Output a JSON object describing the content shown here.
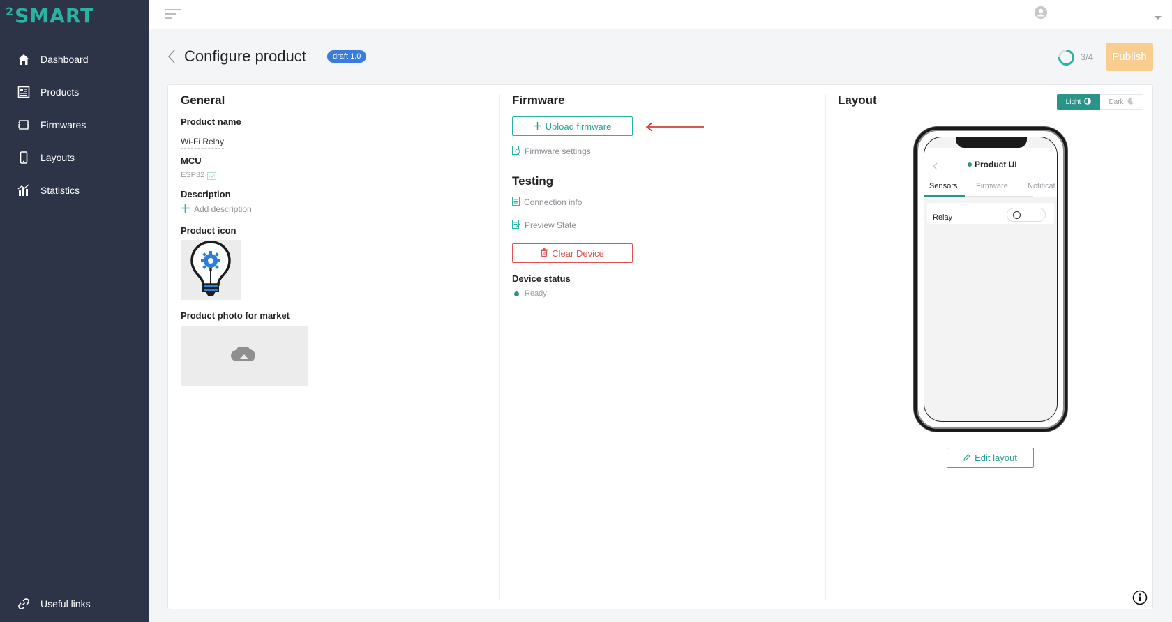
{
  "app": {
    "logo_text": "SMART",
    "logo_sup": "2"
  },
  "sidebar": {
    "items": [
      {
        "label": "Dashboard",
        "icon": "home-icon"
      },
      {
        "label": "Products",
        "icon": "products-icon"
      },
      {
        "label": "Firmwares",
        "icon": "firmwares-icon"
      },
      {
        "label": "Layouts",
        "icon": "layouts-icon"
      },
      {
        "label": "Statistics",
        "icon": "statistics-icon"
      }
    ],
    "footer": {
      "label": "Useful links",
      "icon": "link-icon"
    }
  },
  "header": {
    "title": "Configure product",
    "badge": "draft 1.0",
    "progress_text": "3/4",
    "progress_fraction": 0.75,
    "publish_label": "Publish"
  },
  "general": {
    "heading": "General",
    "product_name_label": "Product name",
    "product_name_value": "Wi-Fi Relay",
    "mcu_label": "MCU",
    "mcu_value": "ESP32",
    "description_label": "Description",
    "add_description": "Add description",
    "product_icon_label": "Product icon",
    "product_photo_label": "Product photo for market"
  },
  "firmware": {
    "heading": "Firmware",
    "upload_label": "Upload firmware",
    "settings_link": "Firmware settings"
  },
  "testing": {
    "heading": "Testing",
    "connection_info": "Connection info",
    "preview_state": "Preview State",
    "clear_device": "Clear Device",
    "device_status_label": "Device status",
    "device_status_value": "Ready"
  },
  "layout": {
    "heading": "Layout",
    "theme_light": "Light",
    "theme_dark": "Dark",
    "edit_layout": "Edit layout",
    "phone": {
      "title": "Product UI",
      "tabs": [
        "Sensors",
        "Firmware",
        "Notificat"
      ],
      "active_tab": "Sensors",
      "relay_label": "Relay"
    }
  },
  "colors": {
    "accent": "#2ab3a3",
    "sidebar_bg": "#2e3447",
    "publish_bg": "#f8cd8f",
    "badge_bg": "#3a7be0",
    "danger": "#e05252",
    "annotation_arrow": "#d11b1b"
  }
}
